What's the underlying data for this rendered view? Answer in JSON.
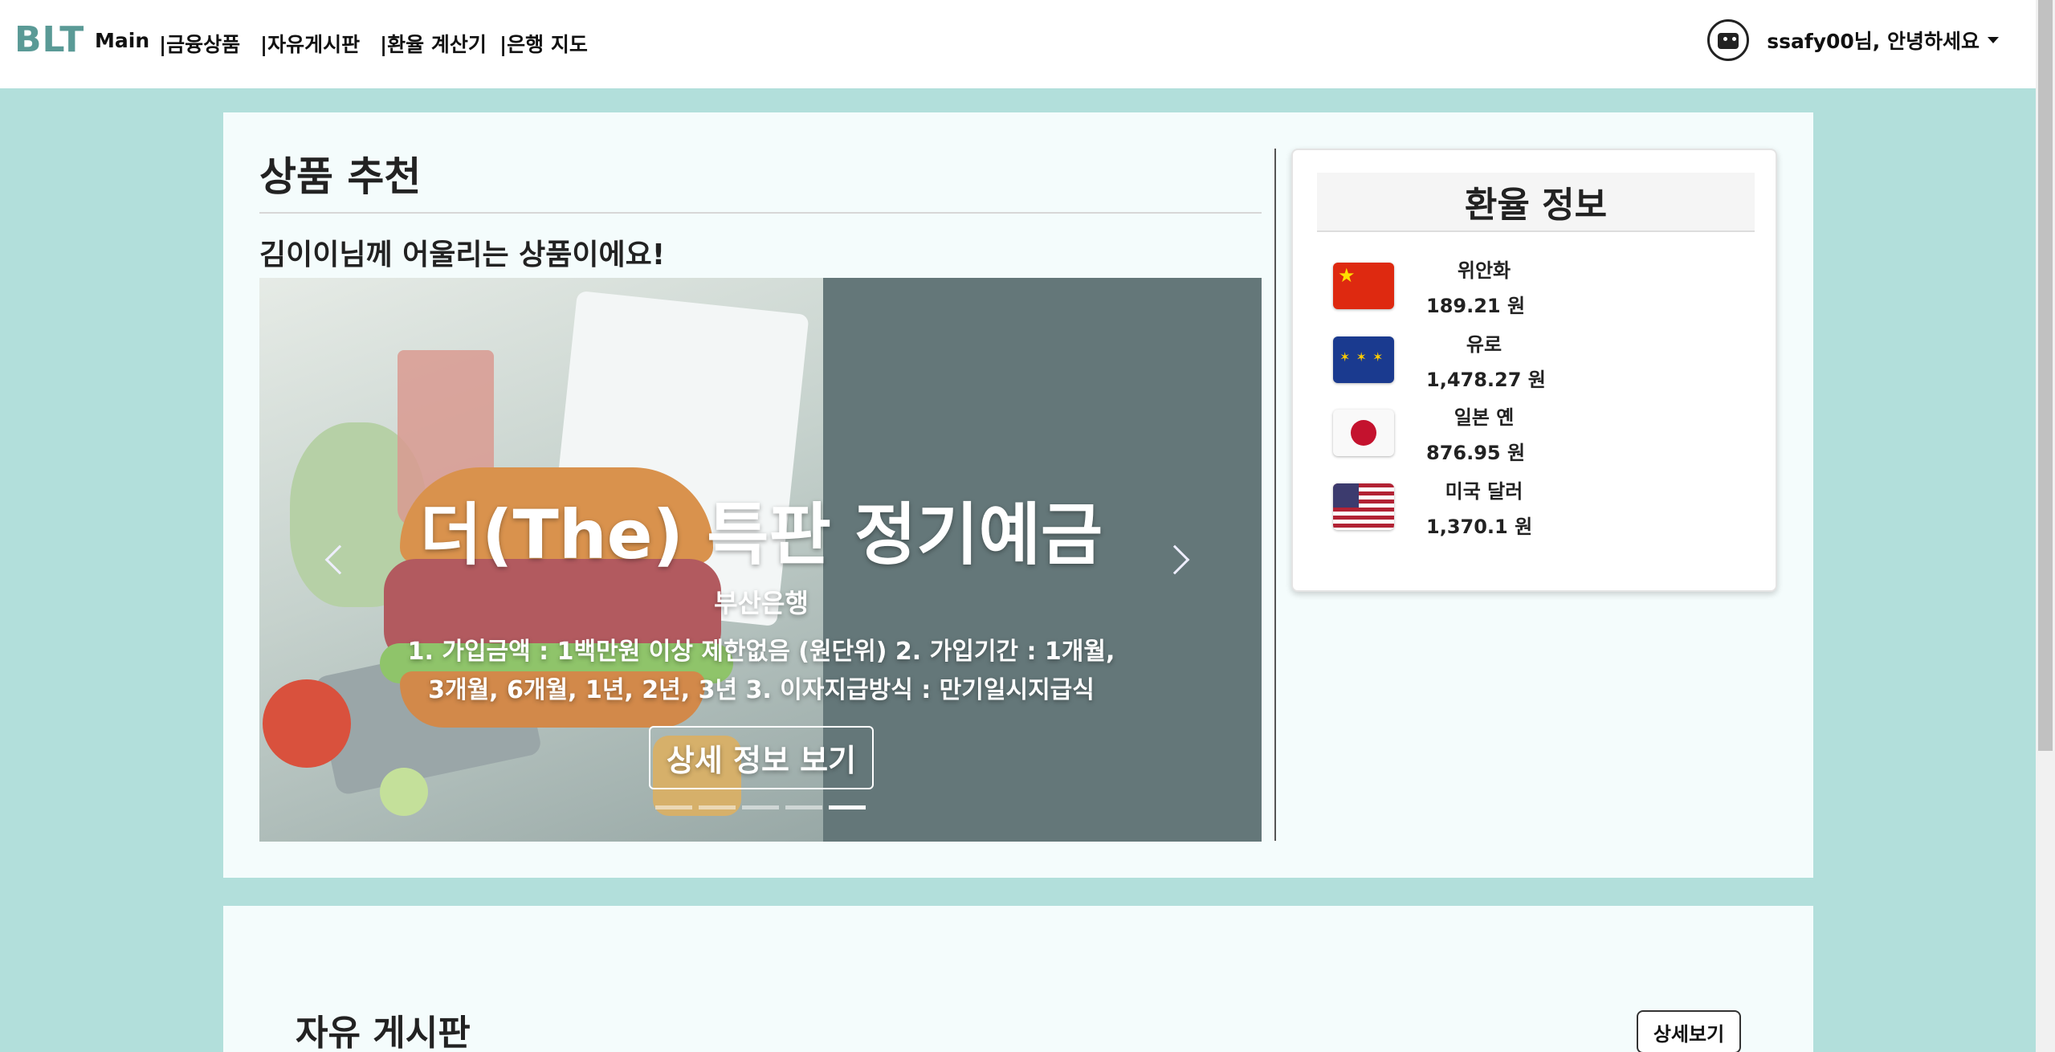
{
  "navbar": {
    "brand": "BLT",
    "items": [
      {
        "label": "Main"
      },
      {
        "label": "|금융상품"
      },
      {
        "label": "|자유게시판"
      },
      {
        "label": "|환율 계산기"
      },
      {
        "label": "|은행 지도"
      }
    ],
    "user_greeting": "ssafy00님, 안녕하세요",
    "avatar_icon": "blt-avatar-icon",
    "caret_icon": "caret-down-icon"
  },
  "recommend": {
    "title": "상품 추천",
    "subtitle": "김이이님께 어울리는 상품이에요!",
    "carousel": {
      "slide_title": "더(The) 특판 정기예금",
      "bank": "부산은행",
      "description": "1. 가입금액 : 1백만원 이상 제한없음 (원단위) 2. 가입기간 : 1개월, 3개월, 6개월, 1년, 2년, 3년 3. 이자지급방식 : 만기일시지급식",
      "button": "상세 정보 보기",
      "prev_icon": "chevron-left-icon",
      "next_icon": "chevron-right-icon",
      "indicator_count": 5,
      "active_indicator": 5
    }
  },
  "exchange": {
    "title": "환율 정보",
    "currencies": [
      {
        "name": "위안화",
        "rate": "189.21 원",
        "flag": "china-flag-icon"
      },
      {
        "name": "유로",
        "rate": "1,478.27 원",
        "flag": "eu-flag-icon"
      },
      {
        "name": "일본 옌",
        "rate": "876.95 원",
        "flag": "japan-flag-icon"
      },
      {
        "name": "미국 달러",
        "rate": "1,370.1 원",
        "flag": "us-flag-icon"
      }
    ]
  },
  "board": {
    "title": "자유 게시판",
    "more_button": "상세보기"
  },
  "colors": {
    "background": "#b2dfdb",
    "brand": "#5a9a96",
    "panel": "#f4fcfc"
  }
}
